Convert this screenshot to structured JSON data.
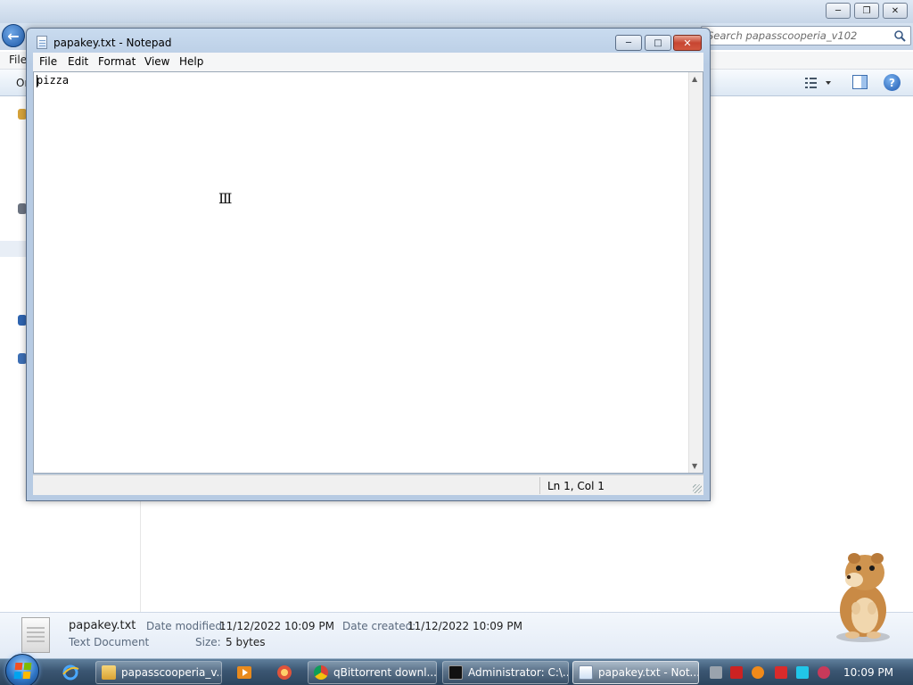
{
  "explorer": {
    "search_placeholder": "Search papasscooperia_v102",
    "menu_file": "File",
    "organize_label": "Or",
    "details": {
      "file_name": "papakey.txt",
      "file_type": "Text Document",
      "date_modified_label": "Date modified:",
      "date_modified": "11/12/2022 10:09 PM",
      "date_created_label": "Date created:",
      "date_created": "11/12/2022 10:09 PM",
      "size_label": "Size:",
      "size": "5 bytes"
    }
  },
  "notepad": {
    "title": "papakey.txt - Notepad",
    "menu": [
      "File",
      "Edit",
      "Format",
      "View",
      "Help"
    ],
    "content": "pizza",
    "status": "Ln 1, Col 1"
  },
  "taskbar": {
    "tasks": [
      {
        "label": "papasscooperia_v...",
        "icon": "folder-icon"
      },
      {
        "label": "qBittorrent downl...",
        "icon": "chrome-icon"
      },
      {
        "label": "Administrator: C:\\...",
        "icon": "cmd-icon"
      },
      {
        "label": "papakey.txt - Not...",
        "icon": "notepad-icon"
      }
    ],
    "clock": "10:09 PM"
  },
  "colors": {
    "taskbar": "#3b5672",
    "close_button": "#c74531",
    "title_gradient": "#c9dbef"
  }
}
